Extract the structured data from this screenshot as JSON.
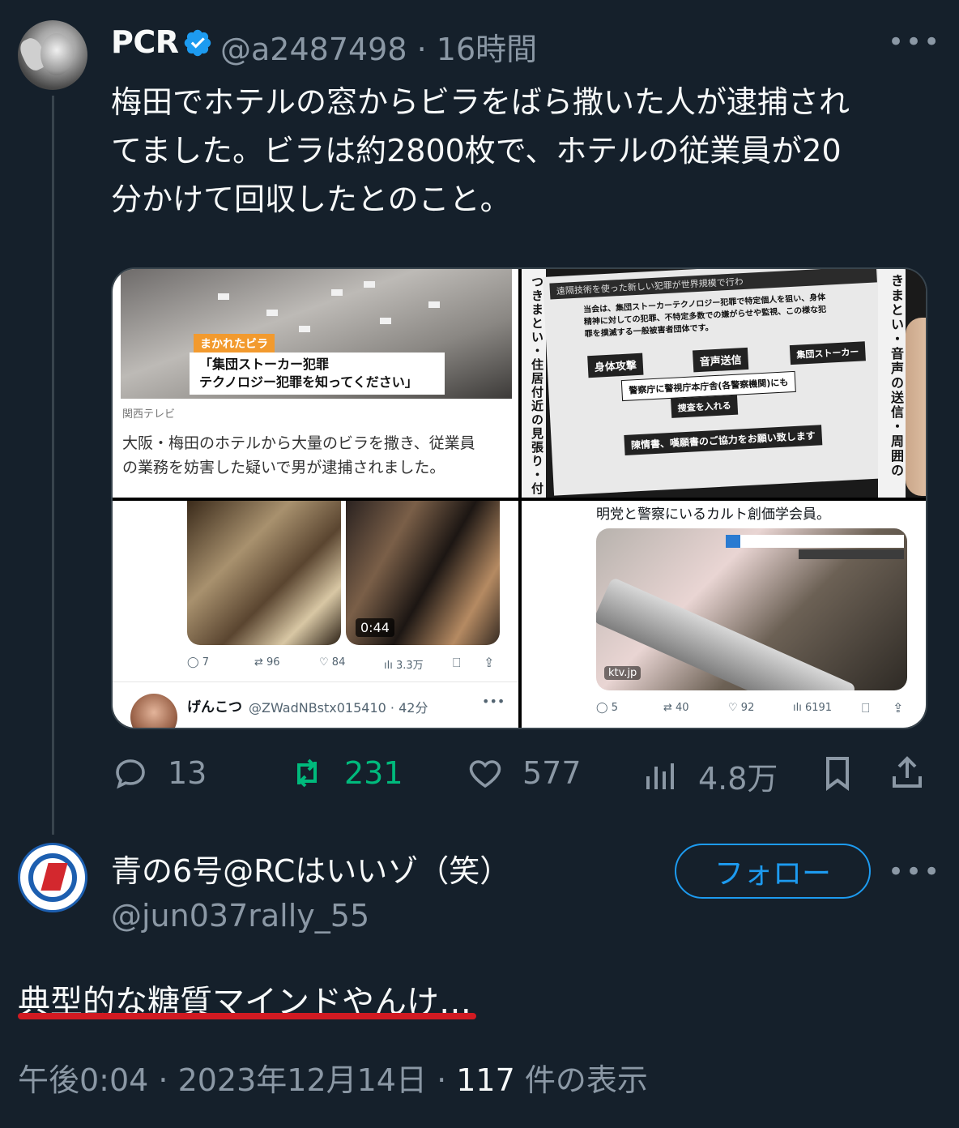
{
  "tweet": {
    "author_name": "PCR",
    "author_meta": "@a2487498 · 16時間",
    "more_label": "•••",
    "text": "梅田でホテルの窓からビラをばら撒いた人が逮捕され\nてました。ビラは約2800枚で、ホテルの従業員が20\n分かけて回収したとのこと。",
    "media": {
      "tile1": {
        "tag": "まかれたビラ",
        "caption": "「集団ストーカー犯罪\nテクノロジー犯罪を知ってください」",
        "source": "関西テレビ",
        "description": "大阪・梅田のホテルから大量のビラを撒き、従業員\nの業務を妨害した疑いで男が逮捕されました。"
      },
      "tile2": {
        "header": "遠隔技術を使った新しい犯罪が世界規模で行わ",
        "body": "当会は、集団ストーカーテクノロジー犯罪で特定個人を狙い、身体\n精神に対しての犯罪、不特定多数での嫌がらせや監視、この様な犯\n罪を撲滅する一般被害者団体です。",
        "pill1": "身体攻撃",
        "pill2": "音声送信",
        "pill3": "集団ストーカー",
        "notice1": "警察庁に警視庁本庁舎(各警察機関)にも",
        "notice2": "捜査を入れる",
        "notice3": "陳情書、嘆願書のご協力をお願い致します",
        "side_left": "つきまとい・住居付近の見張り・付",
        "side_right": "きまとい・音声の送信・周囲の"
      },
      "tile3": {
        "duration": "0:44",
        "stats": {
          "replies": "7",
          "retweets": "96",
          "likes": "84",
          "views": "3.3万"
        },
        "reply_name": "げんこつ",
        "reply_meta": "@ZWadNBstx015410 · 42分",
        "reply_more": "•••"
      },
      "tile4": {
        "text": "明党と警察にいるカルト創価学会員。",
        "source": "ktv.jp",
        "stats": {
          "replies": "5",
          "retweets": "40",
          "likes": "92",
          "views": "6191"
        }
      }
    },
    "actions": {
      "replies": "13",
      "retweets": "231",
      "likes": "577",
      "views": "4.8万"
    }
  },
  "reply": {
    "name": "青の6号@RCはいいゾ（笑）",
    "handle": "@jun037rally_55",
    "follow_label": "フォロー",
    "more_label": "•••",
    "text": "典型的な糖質マインドやんけ…",
    "time": "午後0:04 · 2023年12月14日 · ",
    "view_count": "117",
    "view_suffix": " 件の表示"
  },
  "colors": {
    "background": "#15202b",
    "accent": "#1d9bf0",
    "retweet_green": "#00ba7c",
    "underline_red": "#d11a22"
  }
}
